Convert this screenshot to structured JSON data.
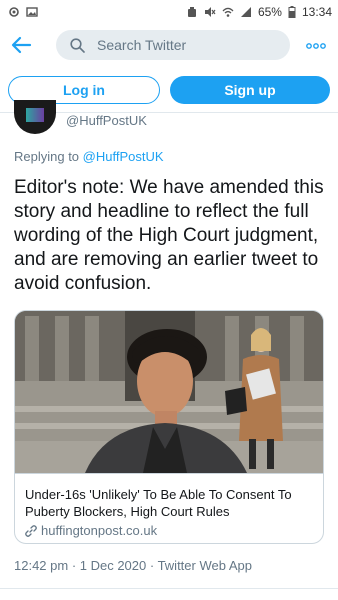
{
  "status_bar": {
    "battery": "65%",
    "time": "13:34"
  },
  "search": {
    "placeholder": "Search Twitter"
  },
  "auth": {
    "login_label": "Log in",
    "signup_label": "Sign up"
  },
  "tweet": {
    "handle": "@HuffPostUK",
    "reply_prefix": "Replying to",
    "reply_to": "@HuffPostUK",
    "text": "Editor's note: We have amended this story and headline to reflect the full wording of the High Court judgment, and are removing an earlier tweet to avoid confusion.",
    "timestamp": "12:42 pm · 1 Dec 2020 · Twitter Web App"
  },
  "card": {
    "title": "Under-16s 'Unlikely' To Be Able To Consent To Puberty Blockers, High Court Rules",
    "domain": "huffingtonpost.co.uk"
  },
  "colors": {
    "accent": "#1da1f2",
    "muted": "#657786",
    "text": "#14171a"
  },
  "icons": {
    "back": "arrow-left-icon",
    "search": "search-icon",
    "more": "more-dots-icon",
    "link": "link-icon"
  }
}
